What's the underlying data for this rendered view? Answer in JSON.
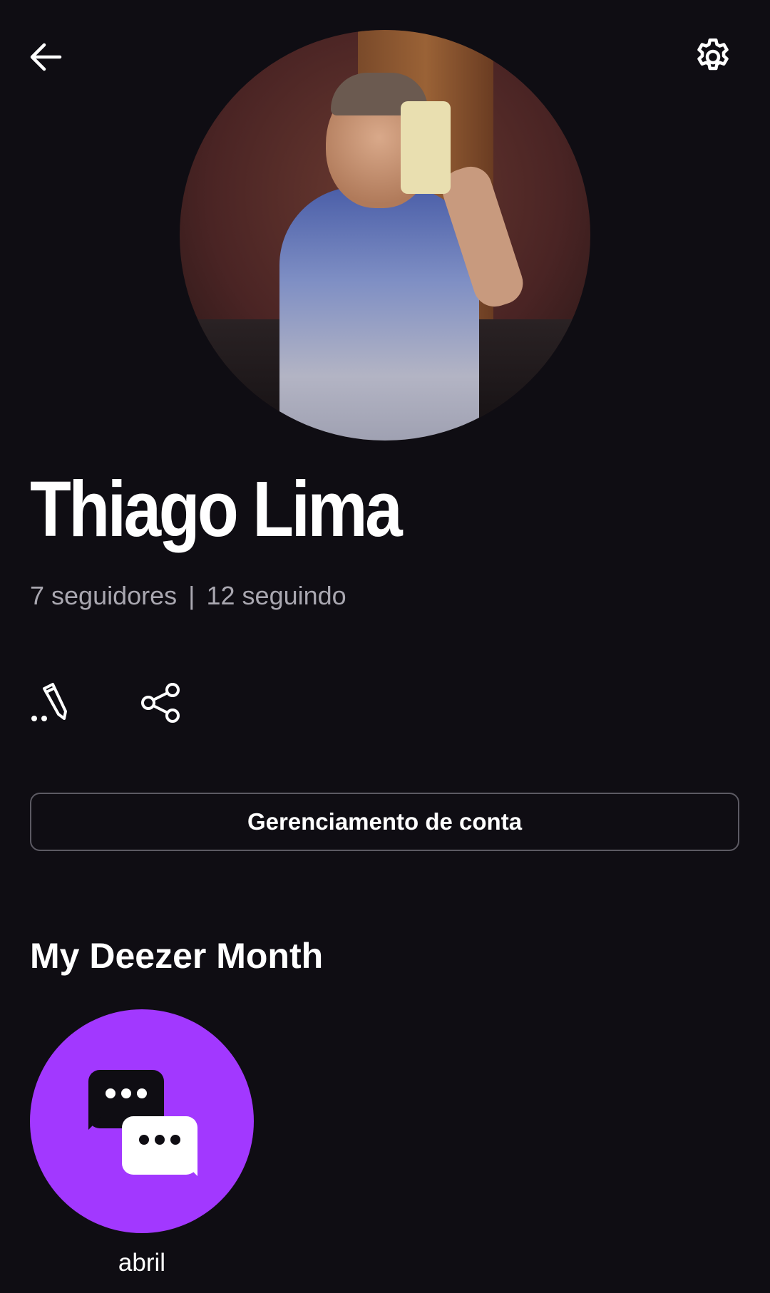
{
  "header": {
    "back_icon": "arrow-left-icon",
    "settings_icon": "gear-icon"
  },
  "profile": {
    "name": "Thiago Lima",
    "followers": "7 seguidores",
    "separator": "|",
    "following": "12 seguindo"
  },
  "actions": {
    "edit_icon": "edit-pencil-icon",
    "share_icon": "share-icon"
  },
  "account_button": "Gerenciamento de conta",
  "month_section": {
    "title": "My Deezer Month",
    "items": [
      {
        "label": "abril",
        "icon": "chat-bubbles-icon",
        "color": "#a238ff"
      }
    ]
  },
  "colors": {
    "background": "#0f0d13",
    "accent": "#a238ff",
    "secondary_text": "#a9a7b0"
  }
}
